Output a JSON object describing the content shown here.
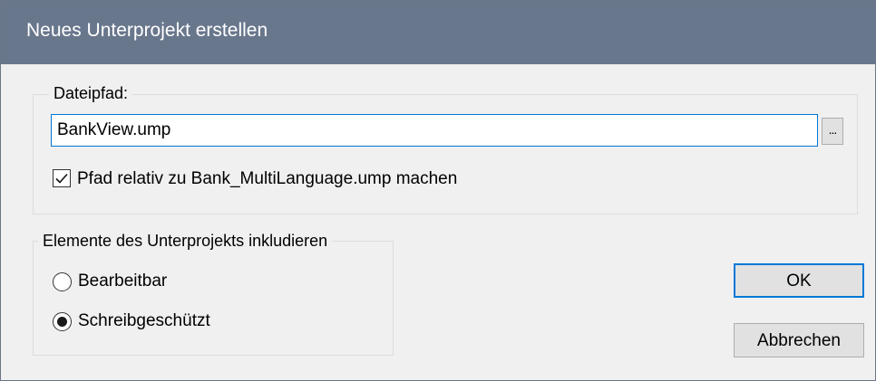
{
  "dialog": {
    "title": "Neues Unterprojekt erstellen",
    "titlebar_color": "#69778d",
    "accent_color": "#0078d7"
  },
  "file_group": {
    "label": "Dateipfad:",
    "path_value": "BankView.ump",
    "browse_label": "...",
    "relative_checkbox": {
      "label": "Pfad relativ zu Bank_MultiLanguage.ump machen",
      "checked": true
    }
  },
  "elements_group": {
    "label": "Elemente des Unterprojekts inkludieren",
    "options": [
      {
        "label": "Bearbeitbar",
        "selected": false
      },
      {
        "label": "Schreibgeschützt",
        "selected": true
      }
    ]
  },
  "buttons": {
    "ok": "OK",
    "cancel": "Abbrechen"
  }
}
